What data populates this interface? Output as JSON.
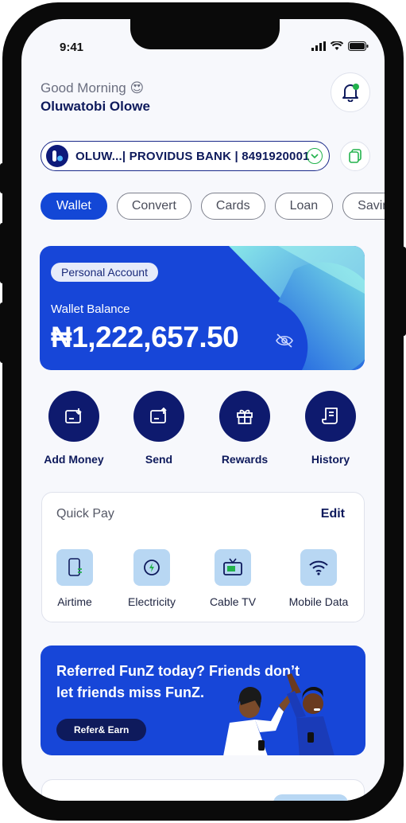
{
  "status": {
    "time": "9:41"
  },
  "header": {
    "greeting": "Good Morning",
    "emoji": "😍",
    "user_name": "Oluwatobi Olowe"
  },
  "account": {
    "text": "OLUW...| PROVIDUS BANK | 8491920001"
  },
  "tabs": [
    {
      "label": "Wallet",
      "active": true
    },
    {
      "label": "Convert",
      "active": false
    },
    {
      "label": "Cards",
      "active": false
    },
    {
      "label": "Loan",
      "active": false
    },
    {
      "label": "Savings",
      "active": false
    }
  ],
  "wallet": {
    "account_type": "Personal Account",
    "balance_label": "Wallet Balance",
    "balance": "₦1,222,657.50"
  },
  "actions": [
    {
      "label": "Add Money",
      "icon": "add-money-icon"
    },
    {
      "label": "Send",
      "icon": "send-icon"
    },
    {
      "label": "Rewards",
      "icon": "gift-icon"
    },
    {
      "label": "History",
      "icon": "receipt-icon"
    }
  ],
  "quick_pay": {
    "title": "Quick Pay",
    "edit_label": "Edit",
    "items": [
      {
        "label": "Airtime",
        "icon": "phone-icon"
      },
      {
        "label": "Electricity",
        "icon": "electricity-icon"
      },
      {
        "label": "Cable TV",
        "icon": "tv-icon"
      },
      {
        "label": "Mobile Data",
        "icon": "wifi-icon"
      }
    ]
  },
  "referral": {
    "text": "Referred FunZ today? Friends don’t let friends miss FunZ.",
    "button_label": "Refer& Earn"
  },
  "colors": {
    "primary": "#1746d8",
    "navy": "#0e1a5c",
    "accent_green": "#22b24c",
    "light_blue": "#b8d7f3"
  }
}
